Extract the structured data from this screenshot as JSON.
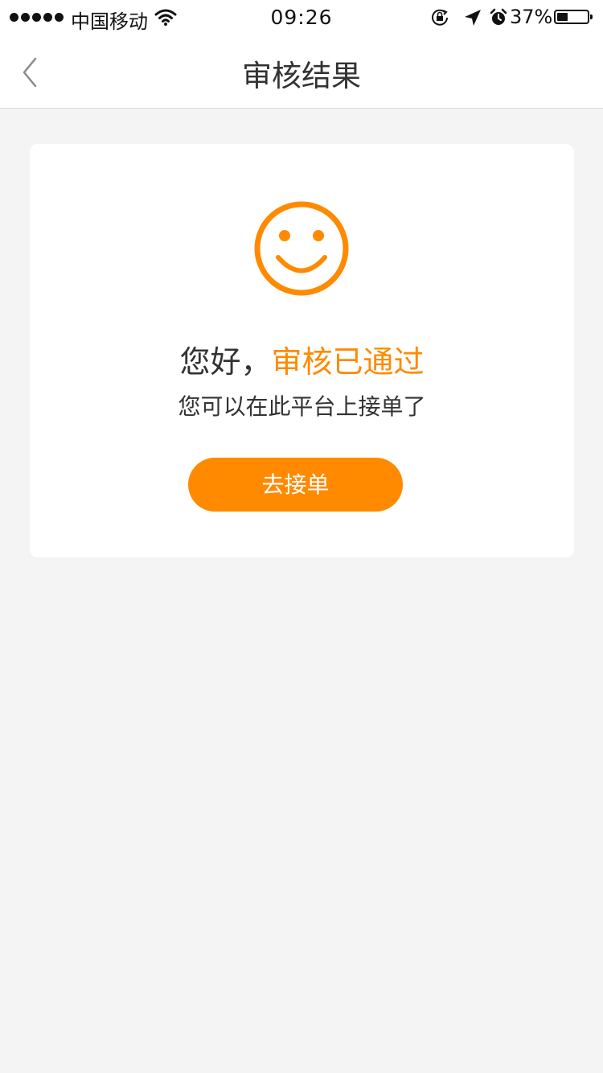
{
  "status_bar": {
    "carrier": "中国移动",
    "time": "09:26",
    "battery_percent_label": "37%",
    "battery_level": 0.37,
    "signal_dots": 5,
    "icons": [
      "signal-dots-icon",
      "wifi-icon",
      "rotation-lock-icon",
      "location-arrow-icon",
      "alarm-icon",
      "battery-icon"
    ]
  },
  "nav": {
    "title": "审核结果",
    "back_icon": "chevron-left-icon"
  },
  "result": {
    "icon": "smiley-face-icon",
    "greeting": "您好，",
    "status": "审核已通过",
    "message": "您可以在此平台上接单了",
    "action_label": "去接单"
  },
  "colors": {
    "accent": "#ff8a00",
    "page_background": "#f4f4f4",
    "card_background": "#ffffff",
    "text": "#333333"
  }
}
